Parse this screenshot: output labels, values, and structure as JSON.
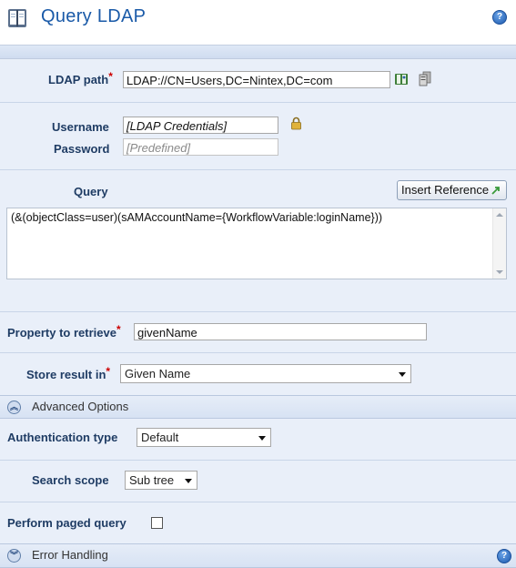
{
  "header": {
    "title": "Query LDAP",
    "icon": "book-icon",
    "help_icon": "help-icon"
  },
  "ldap_path": {
    "label": "LDAP path",
    "required_mark": "*",
    "value": "LDAP://CN=Users,DC=Nintex,DC=com",
    "browse_icon": "address-book-icon",
    "server_icon": "server-icon"
  },
  "credentials": {
    "username_label": "Username",
    "username_value": "[LDAP Credentials]",
    "password_label": "Password",
    "password_value": "[Predefined]",
    "lock_icon": "lock-icon"
  },
  "query": {
    "label": "Query",
    "insert_reference_label": "Insert Reference",
    "value": "(&(objectClass=user)(sAMAccountName={WorkflowVariable:loginName}))"
  },
  "property": {
    "label": "Property to retrieve",
    "required_mark": "*",
    "value": "givenName"
  },
  "store_result": {
    "label": "Store result in",
    "required_mark": "*",
    "value": "Given Name"
  },
  "advanced": {
    "title": "Advanced Options",
    "auth_label": "Authentication type",
    "auth_value": "Default",
    "scope_label": "Search scope",
    "scope_value": "Sub tree",
    "paged_label": "Perform paged query",
    "paged_checked": false
  },
  "error_handling": {
    "title": "Error Handling"
  },
  "colors": {
    "accent": "#1a5aa8",
    "label": "#1f3c64",
    "required": "#cc0000",
    "background": "#e9eff9"
  }
}
